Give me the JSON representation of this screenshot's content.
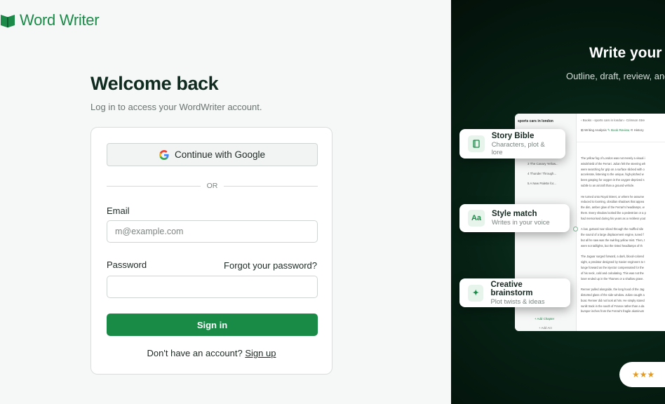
{
  "brand": {
    "name": "Word Writer"
  },
  "login": {
    "title": "Welcome back",
    "subtitle": "Log in to access your WordWriter account.",
    "google_label": "Continue with Google",
    "divider": "OR",
    "email_label": "Email",
    "email_placeholder": "m@example.com",
    "email_value": "",
    "password_label": "Password",
    "password_value": "",
    "forgot_label": "Forgot your password?",
    "signin_label": "Sign in",
    "signup_prompt": "Don't have an account?",
    "signup_link": "Sign up"
  },
  "hero": {
    "title": "Write your b",
    "subtitle": "Outline, draft, review, and"
  },
  "features": [
    {
      "title": "Story Bible",
      "subtitle": "Characters, plot & lore",
      "icon": "book-icon"
    },
    {
      "title": "Style match",
      "subtitle": "Writes in your voice",
      "icon": "text-aa-icon"
    },
    {
      "title": "Creative brainstorm",
      "subtitle": "Plot twists & ideas",
      "icon": "sparkle-icon"
    }
  ],
  "mock": {
    "project": "sports cars in london",
    "breadcrumb": "‹  Books  ›  sports cars in london  ›  Crimson Stre",
    "tabs": [
      "Writing Analysis",
      "Book Review",
      "History"
    ],
    "chapters": [
      "3  The Canary Yellow...",
      "4  Thunder Through...",
      "5  A New Palette for..."
    ],
    "add_chapter": "+ Add Chapter",
    "add_act": "+ Add Act",
    "paragraphs": [
      "The yellow fog of London was not merely a visual i",
      "windshield of the Ferrari. Julian felt the steering wh",
      "were searching for grip on a surface slicked with o",
      "accelerate, listening to the unique, high-pitched w",
      "been gasping for oxygen in the oxygen-deprived s",
      "subtle to an aircraft than a ground vehicle.",
      "",
      "He turned onto Royal Street, or where he assume",
      "reduced to looming, obsidian shadows that appea",
      "the dim, amber glow of the Ferrari's headlamps, w",
      "them. Every shadow looked like a pedestrian or a p",
      "had memorised during his years as a reckless yout",
      "",
      "A low, guttural roar sliced through the muffled sile",
      "the sound of a large displacement engine, tuned f",
      "but all he saw was the swirling yellow mist. Then, t",
      "were not taillights, but the tinted headlamps of th",
      "",
      "The Jaguar surged forward, a dark, blood-colored",
      "sight, a predator designed by Savier engineers to t",
      "lunge forward as the injector compensated for the",
      "of his neck, cold and calculating. This was not the",
      "loser ended up in the Thames or a shallow grave.",
      "",
      "Renner pulled alongside, the long hood of the Jag",
      "distorted glass of the side window. Julian caught a",
      "boat. Renner did not look at him. He simply stared",
      "sunlit track in the south of France rather than a da",
      "bumper inches from the Ferrari's fragile aluminum"
    ]
  },
  "rating": {
    "stars": "★★★"
  }
}
